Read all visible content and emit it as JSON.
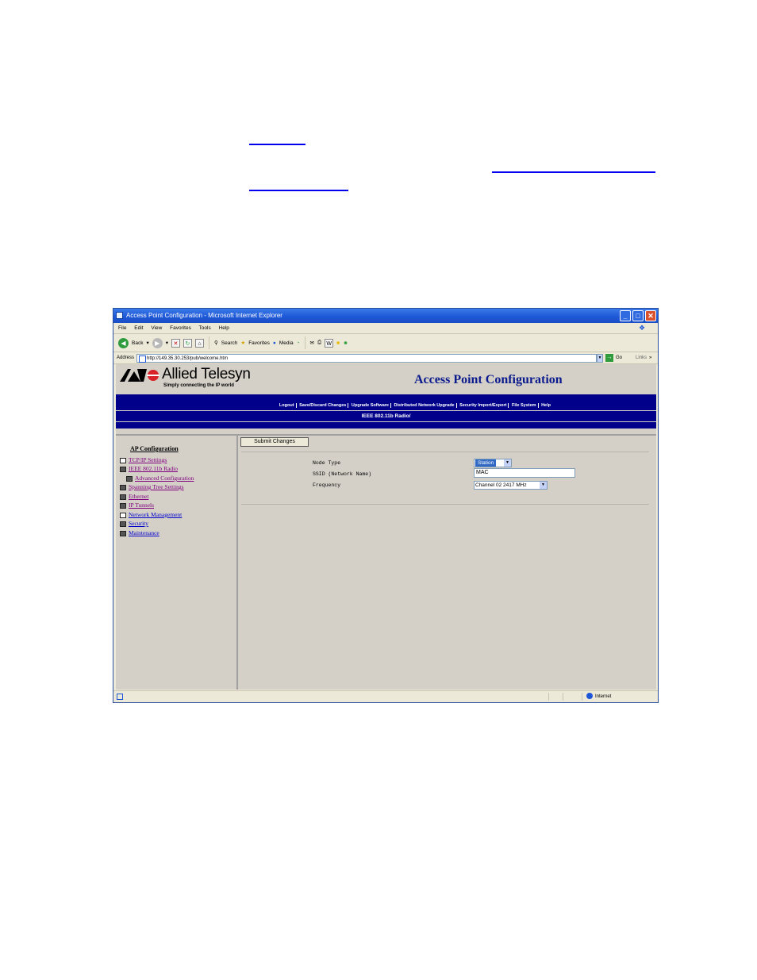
{
  "window": {
    "title": "Access Point Configuration - Microsoft Internet Explorer",
    "buttons": {
      "minimize": "_",
      "maximize": "□",
      "close": "✕"
    }
  },
  "menu": [
    "File",
    "Edit",
    "View",
    "Favorites",
    "Tools",
    "Help"
  ],
  "toolbar": {
    "back": "Back",
    "search": "Search",
    "favorites": "Favorites",
    "media": "Media"
  },
  "address": {
    "label": "Address",
    "url": "http://149.35.30.253/pub/welcome.htm",
    "go": "Go",
    "links": "Links"
  },
  "header": {
    "brand": "Allied Telesyn",
    "tagline": "Simply connecting the IP world",
    "title": "Access Point Configuration"
  },
  "nav": {
    "links": [
      "Logout",
      "Save/Discard Changes",
      "Upgrade Software",
      "Distributed Network Upgrade",
      "Security Import/Export",
      "File System",
      "Help"
    ],
    "breadcrumb": "IEEE 802.11b Radio/"
  },
  "sidebar": {
    "heading": "AP Configuration",
    "items": [
      {
        "label": "TCP/IP Settings",
        "icon": "page-icon",
        "visited": true
      },
      {
        "label": "IEEE 802.11b Radio",
        "icon": "folder-open-icon",
        "visited": true
      },
      {
        "label": "Advanced Configuration",
        "icon": "folder-icon",
        "visited": true
      },
      {
        "label": "Spanning Tree Settings",
        "icon": "folder-icon",
        "visited": true
      },
      {
        "label": "Ethernet",
        "icon": "folder-icon",
        "visited": true
      },
      {
        "label": "IP Tunnels",
        "icon": "folder-icon",
        "visited": true
      },
      {
        "label": "Network Management",
        "icon": "page-icon",
        "visited": false
      },
      {
        "label": "Security",
        "icon": "folder-icon",
        "visited": false
      },
      {
        "label": "Maintenance",
        "icon": "folder-icon",
        "visited": false
      }
    ]
  },
  "form": {
    "submit_label": "Submit Changes",
    "node_type": {
      "label": "Node Type",
      "value": "Station"
    },
    "ssid": {
      "label": "SSID (Network Name)",
      "value": "MAC"
    },
    "frequency": {
      "label": "Frequency",
      "value": "Channel 02 2417 MHz"
    }
  },
  "status": {
    "zone": "Internet"
  }
}
